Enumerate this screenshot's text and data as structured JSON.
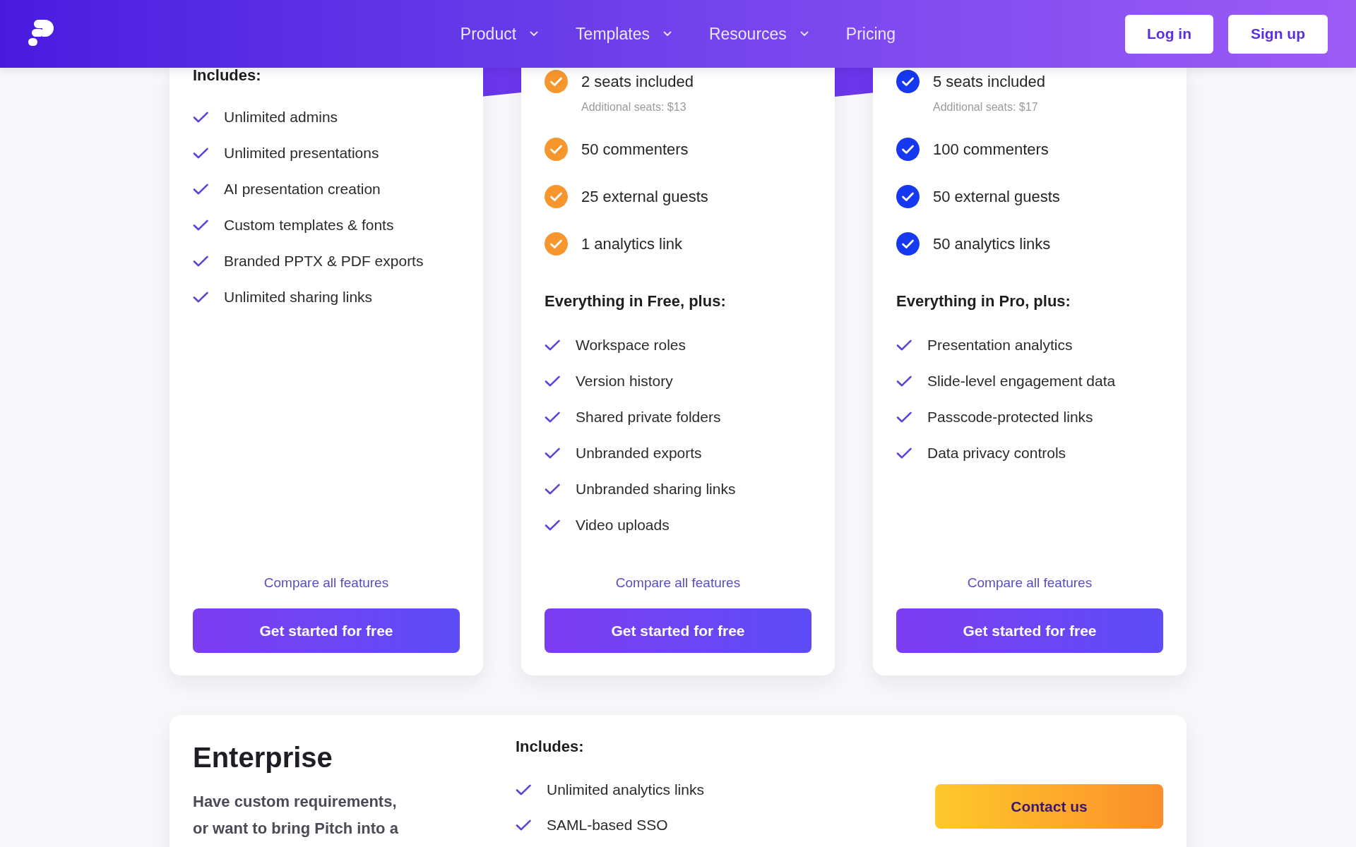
{
  "header": {
    "nav_links": [
      {
        "label": "Product",
        "has_menu": true
      },
      {
        "label": "Templates",
        "has_menu": true
      },
      {
        "label": "Resources",
        "has_menu": true
      },
      {
        "label": "Pricing",
        "has_menu": false
      }
    ],
    "buttons": [
      "Log in",
      "Sign up"
    ]
  },
  "plans": [
    {
      "sections": [
        {
          "heading": "Includes:",
          "items": [
            "Unlimited admins",
            "Unlimited presentations",
            "AI presentation creation",
            "Custom templates & fonts",
            "Branded PPTX & PDF exports",
            "Unlimited sharing links"
          ]
        }
      ],
      "compare_link": "Compare all features",
      "cta": "Get started for free"
    },
    {
      "color": "#f7962c",
      "limits": [
        {
          "text": "2 seats included",
          "note": "Additional seats: $13"
        },
        {
          "text": "50 commenters"
        },
        {
          "text": "25 external guests"
        },
        {
          "text": "1 analytics link"
        }
      ],
      "sections": [
        {
          "heading": "Everything in Free, plus:",
          "items": [
            "Workspace roles",
            "Version history",
            "Shared private folders",
            "Unbranded exports",
            "Unbranded sharing links",
            "Video uploads"
          ]
        }
      ],
      "compare_link": "Compare all features",
      "cta": "Get started for free"
    },
    {
      "color": "#1538f0",
      "limits": [
        {
          "text": "5 seats included",
          "note": "Additional seats: $17"
        },
        {
          "text": "100 commenters"
        },
        {
          "text": "50 external guests"
        },
        {
          "text": "50 analytics links"
        }
      ],
      "sections": [
        {
          "heading": "Everything in Pro, plus:",
          "items": [
            "Presentation analytics",
            "Slide-level engagement data",
            "Passcode-protected links",
            "Data privacy controls"
          ]
        }
      ],
      "compare_link": "Compare all features",
      "cta": "Get started for free"
    }
  ],
  "enterprise": {
    "title": "Enterprise",
    "description_lines": [
      "Have custom requirements,",
      "or want to bring Pitch into a"
    ],
    "includes_heading": "Includes:",
    "items": [
      "Unlimited analytics links",
      "SAML-based SSO"
    ],
    "cta": "Contact us"
  }
}
